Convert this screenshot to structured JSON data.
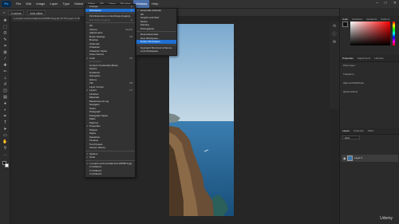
{
  "app": {
    "logo": "Ps"
  },
  "menubar": {
    "items": [
      "File",
      "Edit",
      "Image",
      "Layer",
      "Type",
      "Select",
      "Filter",
      "3D",
      "View",
      "Plugins",
      "Window",
      "Help"
    ],
    "active": "Window"
  },
  "window_controls": [
    "–",
    "□",
    "✕"
  ],
  "options": {
    "preset": "Custom",
    "field": "Anti-alias"
  },
  "share_label": "Share",
  "doc_tab": "1-people-venture-balanced-1560672.jpg @ 16.7% (Layer 0, RGB/8) *",
  "window_menu": {
    "items": [
      {
        "label": "Arrange",
        "arrow": true
      },
      {
        "label": "Workspace",
        "arrow": true,
        "selected": true
      },
      {
        "label": "Find Extensions on Exchange (legacy)...",
        "sep_before": true
      },
      {
        "label": "Extensions (legacy)",
        "arrow": true,
        "disabled": true
      },
      {
        "label": "3D",
        "sep_before": true
      },
      {
        "label": "Actions",
        "shortcut": "Alt+F9"
      },
      {
        "label": "Adjustments"
      },
      {
        "label": "Brush Settings",
        "shortcut": "F5"
      },
      {
        "label": "Brushes"
      },
      {
        "label": "Channels"
      },
      {
        "label": "Character"
      },
      {
        "label": "Character Styles"
      },
      {
        "label": "Clone Source"
      },
      {
        "label": "Color",
        "shortcut": "F6",
        "check": true
      },
      {
        "label": "Comments",
        "disabled": true
      },
      {
        "label": "Content Credentials (Beta)"
      },
      {
        "label": "Glyphs"
      },
      {
        "label": "Gradients"
      },
      {
        "label": "Histogram"
      },
      {
        "label": "History"
      },
      {
        "label": "Info",
        "shortcut": "F8"
      },
      {
        "label": "Layer Comps"
      },
      {
        "label": "Layers",
        "shortcut": "F7",
        "check": true
      },
      {
        "label": "Libraries"
      },
      {
        "label": "Materials"
      },
      {
        "label": "Measurement Log"
      },
      {
        "label": "Navigator"
      },
      {
        "label": "Notes"
      },
      {
        "label": "Paragraph"
      },
      {
        "label": "Paragraph Styles"
      },
      {
        "label": "Paths"
      },
      {
        "label": "Patterns"
      },
      {
        "label": "Properties",
        "check": true
      },
      {
        "label": "Shapes"
      },
      {
        "label": "Styles"
      },
      {
        "label": "Swatches"
      },
      {
        "label": "Timeline"
      },
      {
        "label": "Tool Presets"
      },
      {
        "label": "Version History"
      },
      {
        "label": "Options",
        "check": true,
        "sep_before": true
      },
      {
        "label": "Tools",
        "check": true
      },
      {
        "label": "1 people-venture-balanced-1560672.jpg",
        "check": true,
        "sep_before": true
      },
      {
        "label": "2 Untitled-1"
      },
      {
        "label": "3 Untitled-2"
      },
      {
        "label": "4 Untitled-3"
      }
    ]
  },
  "workspace_menu": {
    "items": [
      {
        "label": "Essentials (Default)",
        "check": true
      },
      {
        "label": "3D"
      },
      {
        "label": "Graphic and Web"
      },
      {
        "label": "Motion"
      },
      {
        "label": "Painting"
      },
      {
        "label": "Photography"
      },
      {
        "label": "Reset Essentials",
        "sep_before": true
      },
      {
        "label": "New Workspace..."
      },
      {
        "label": "Delete Workspace...",
        "selected": true
      },
      {
        "label": "Keyboard Shortcuts & Menus...",
        "sep_before": true
      },
      {
        "label": "Lock Workspace"
      }
    ]
  },
  "panels": {
    "color_tabs": [
      "Color",
      "Swatches",
      "Gradients",
      "Patterns"
    ],
    "properties_tabs": [
      "Properties",
      "Adjustments",
      "Libraries"
    ],
    "properties_rows": [
      "Pixel Layer",
      "Transform",
      "Align and Distribute",
      "Quick Actions"
    ],
    "layers_tabs": [
      "Layers",
      "Channels",
      "Paths"
    ],
    "layers_filter": "Kind",
    "layer_name": "Layer 0"
  },
  "watermark": "Udemy",
  "colors": {
    "accent": "#1473e6",
    "highlight": "#1f6fd1",
    "sea": "#2f6a98",
    "sky": "#9fc3dc"
  }
}
